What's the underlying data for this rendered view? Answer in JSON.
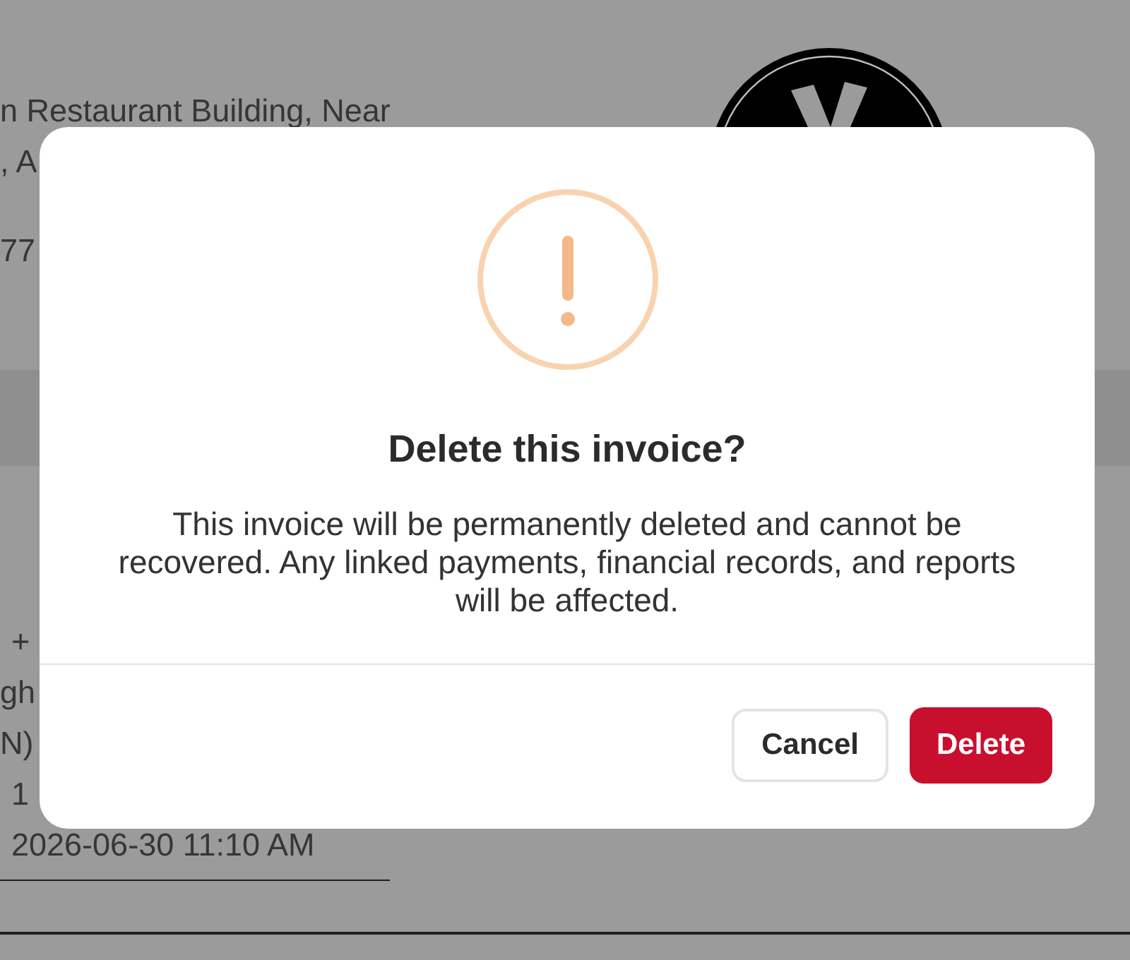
{
  "background": {
    "address_lines": [
      "n Restaurant Building, Near",
      ", A"
    ],
    "phone": "77",
    "details": [
      {
        "text": "+",
        "kind": "value"
      },
      {
        "text": "gh",
        "kind": "label"
      },
      {
        "text": "N)",
        "kind": "label"
      },
      {
        "text": "1",
        "kind": "value"
      },
      {
        "text": "2026-06-30 11:10 AM",
        "kind": "value"
      }
    ]
  },
  "dialog": {
    "title": "Delete this invoice?",
    "message": "This invoice will be permanently deleted and cannot be recovered. Any linked payments, financial records, and reports will be affected.",
    "buttons": [
      {
        "label": "Cancel",
        "kind": "secondary"
      },
      {
        "label": "Delete",
        "kind": "destructive"
      }
    ]
  }
}
